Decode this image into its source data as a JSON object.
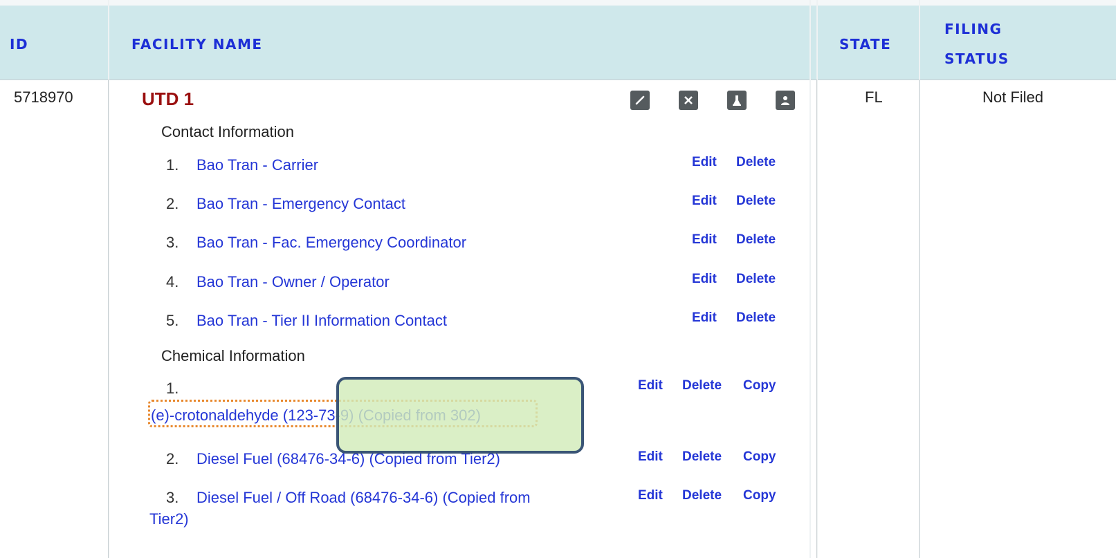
{
  "table": {
    "headers": {
      "id": "ID",
      "facility_name": "FACILITY NAME",
      "state": "STATE",
      "filing_status_line1": "FILING",
      "filing_status_line2": "STATUS"
    },
    "row": {
      "id": "5718970",
      "facility_name": "UTD 1",
      "state": "FL",
      "filing_status": "Not Filed",
      "icons": [
        "edit-icon",
        "delete-icon",
        "flask-icon",
        "user-icon"
      ],
      "contact_section_label": "Contact Information",
      "contacts": [
        {
          "num": "1.",
          "label": "Bao Tran - Carrier",
          "edit": "Edit",
          "delete": "Delete"
        },
        {
          "num": "2.",
          "label": "Bao Tran - Emergency Contact",
          "edit": "Edit",
          "delete": "Delete"
        },
        {
          "num": "3.",
          "label": "Bao Tran - Fac. Emergency Coordinator",
          "edit": "Edit",
          "delete": "Delete"
        },
        {
          "num": "4.",
          "label": "Bao Tran - Owner / Operator",
          "edit": "Edit",
          "delete": "Delete"
        },
        {
          "num": "5.",
          "label": "Bao Tran - Tier II Information Contact",
          "edit": "Edit",
          "delete": "Delete"
        }
      ],
      "chemical_section_label": "Chemical Information",
      "chemicals": [
        {
          "num": "1.",
          "label": "(e)-crotonaldehyde (123-73-9) (Copied from 302)",
          "edit": "Edit",
          "delete": "Delete",
          "copy": "Copy"
        },
        {
          "num": "2.",
          "label": "Diesel Fuel (68476-34-6) (Copied from Tier2)",
          "edit": "Edit",
          "delete": "Delete",
          "copy": "Copy"
        },
        {
          "num": "3.",
          "label_line1": "Diesel Fuel / Off Road (68476-34-6) (Copied from",
          "label_line2": "Tier2)",
          "edit": "Edit",
          "delete": "Delete",
          "copy": "Copy"
        }
      ]
    }
  },
  "colors": {
    "header_bg": "#cfe8eb",
    "header_text": "#1d2fd6",
    "facility_name": "#9a0f0f",
    "link": "#2436d6",
    "highlight_border": "#e8882d",
    "callout_fill": "#d2ebb9",
    "callout_border": "#3a5576"
  }
}
